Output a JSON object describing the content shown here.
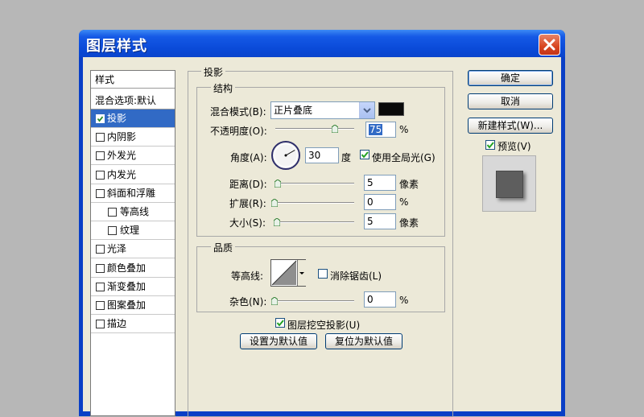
{
  "dialog_title": "图层样式",
  "styles_list": {
    "header": "样式",
    "blend_options": "混合选项:默认",
    "items": [
      {
        "label": "投影",
        "checked": true,
        "selected": true,
        "indent": false
      },
      {
        "label": "内阴影",
        "checked": false,
        "selected": false,
        "indent": false
      },
      {
        "label": "外发光",
        "checked": false,
        "selected": false,
        "indent": false
      },
      {
        "label": "内发光",
        "checked": false,
        "selected": false,
        "indent": false
      },
      {
        "label": "斜面和浮雕",
        "checked": false,
        "selected": false,
        "indent": false
      },
      {
        "label": "等高线",
        "checked": false,
        "selected": false,
        "indent": true
      },
      {
        "label": "纹理",
        "checked": false,
        "selected": false,
        "indent": true
      },
      {
        "label": "光泽",
        "checked": false,
        "selected": false,
        "indent": false
      },
      {
        "label": "颜色叠加",
        "checked": false,
        "selected": false,
        "indent": false
      },
      {
        "label": "渐变叠加",
        "checked": false,
        "selected": false,
        "indent": false
      },
      {
        "label": "图案叠加",
        "checked": false,
        "selected": false,
        "indent": false
      },
      {
        "label": "描边",
        "checked": false,
        "selected": false,
        "indent": false
      }
    ]
  },
  "drop_shadow": {
    "section_title": "投影",
    "structure_title": "结构",
    "blend_mode_label": "混合模式(B):",
    "blend_mode_value": "正片叠底",
    "shadow_color": "#0a0a0a",
    "opacity_label": "不透明度(O):",
    "opacity_value": "75",
    "opacity_unit": "%",
    "opacity_level": 0.75,
    "angle_label": "角度(A):",
    "angle_value": "30",
    "angle_unit": "度",
    "global_light_label": "使用全局光(G)",
    "global_light_checked": true,
    "distance_label": "距离(D):",
    "distance_value": "5",
    "distance_unit": "像素",
    "spread_label": "扩展(R):",
    "spread_value": "0",
    "spread_unit": "%",
    "size_label": "大小(S):",
    "size_value": "5",
    "size_unit": "像素",
    "quality_title": "品质",
    "contour_label": "等高线:",
    "antialias_label": "消除锯齿(L)",
    "antialias_checked": false,
    "noise_label": "杂色(N):",
    "noise_value": "0",
    "noise_unit": "%",
    "knockout_label": "图层挖空投影(U)",
    "knockout_checked": true,
    "make_default": "设置为默认值",
    "reset_default": "复位为默认值"
  },
  "buttons": {
    "ok": "确定",
    "cancel": "取消",
    "new_style": "新建样式(W)...",
    "preview_label": "预览(V)",
    "preview_checked": true
  },
  "colors": {
    "title_bar": "#1559e6",
    "selection": "#316ac5",
    "dialog_bg": "#ece9d8",
    "close_button": "#d8451f"
  }
}
